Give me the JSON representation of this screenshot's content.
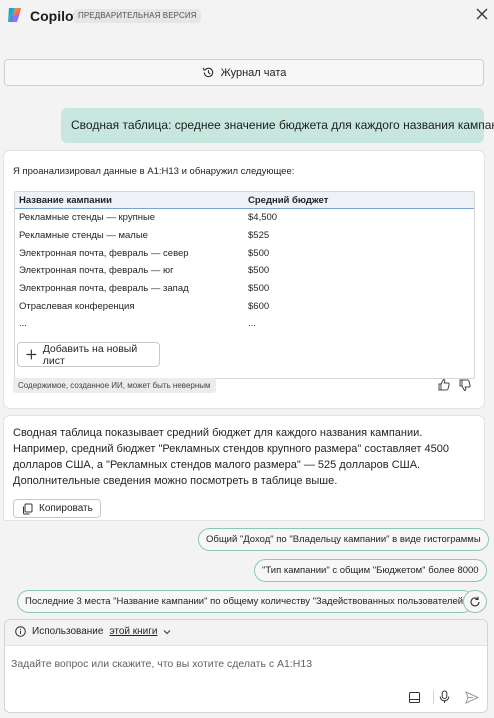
{
  "header": {
    "title": "Copilot",
    "badge": "ПРЕДВАРИТЕЛЬНАЯ ВЕРСИЯ",
    "close_icon": "close-icon"
  },
  "history": {
    "label": "Журнал чата",
    "icon": "history-icon"
  },
  "user_message": "Сводная таблица: среднее значение бюджета для каждого названия кампании",
  "response": {
    "intro": "Я проанализировал данные в A1:H13 и обнаружил следующее:",
    "table": {
      "headers": [
        "Название кампании",
        "Средний бюджет"
      ],
      "rows": [
        [
          "Рекламные стенды — крупные",
          "$4,500"
        ],
        [
          "Рекламные стенды — малые",
          "$525"
        ],
        [
          "Электронная почта, февраль — север",
          "$500"
        ],
        [
          "Электронная почта, февраль — юг",
          "$500"
        ],
        [
          "Электронная почта, февраль — запад",
          "$500"
        ],
        [
          "Отраслевая конференция",
          "$600"
        ],
        [
          "...",
          "..."
        ]
      ]
    },
    "add_sheet_label": "Добавить на новый лист",
    "ai_note": "Содержимое, созданное ИИ, может быть неверным"
  },
  "answer": {
    "text": "Сводная таблица показывает средний бюджет для каждого названия кампании. Например, средний бюджет \"Рекламных стендов крупного размера\" составляет 4500 долларов США, а \"Рекламных стендов малого размера\" — 525 долларов США. Дополнительные сведения можно посмотреть в таблице выше.",
    "copy_label": "Копировать"
  },
  "suggestions": [
    "Общий \"Доход\" по \"Владельцу кампании\" в виде гистограммы",
    "\"Тип кампании\" с общим \"Бюджетом\" более 8000",
    "Последние 3 места \"Название кампании\" по общему количеству \"Задействованных пользователей\""
  ],
  "compose": {
    "context_prefix": "Использование",
    "context_link": "этой книги",
    "placeholder": "Задайте вопрос или скажите, что вы хотите сделать с A1:H13"
  },
  "colors": {
    "accent": "#c7e7de",
    "suggestion_border": "#8fc7b7",
    "table_header_rule": "#7aa2d9"
  }
}
